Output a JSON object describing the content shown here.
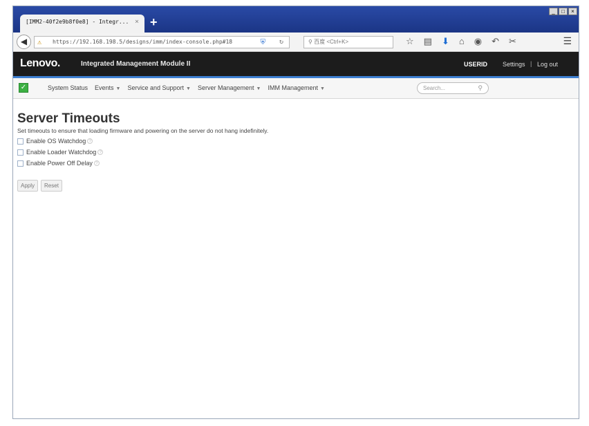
{
  "browser": {
    "tab_title": "[IMM2-40f2e9b8f0e8] - Integr...",
    "tab_close": "×",
    "new_tab": "+",
    "url": "https://192.168.198.5/designs/imm/index-console.php#18",
    "search_placeholder": "百度 <Ctrl+K>",
    "window_buttons": [
      "_",
      "□",
      "×"
    ]
  },
  "header": {
    "brand": "Lenovo.",
    "product": "Integrated Management Module II",
    "user": "USERID",
    "settings": "Settings",
    "separator": "|",
    "logout": "Log out"
  },
  "menu": {
    "items": [
      {
        "label": "System Status",
        "has_caret": false
      },
      {
        "label": "Events",
        "has_caret": true
      },
      {
        "label": "Service and Support",
        "has_caret": true
      },
      {
        "label": "Server Management",
        "has_caret": true
      },
      {
        "label": "IMM Management",
        "has_caret": true
      }
    ],
    "search_placeholder": "Search...",
    "status_color": "#3cb043"
  },
  "page": {
    "title": "Server Timeouts",
    "description": "Set timeouts to ensure that loading firmware and powering on the server do not hang indefinitely.",
    "options": [
      {
        "label": "Enable OS Watchdog",
        "checked": false
      },
      {
        "label": "Enable Loader Watchdog",
        "checked": false
      },
      {
        "label": "Enable Power Off Delay",
        "checked": false
      }
    ],
    "apply_label": "Apply",
    "reset_label": "Reset"
  }
}
